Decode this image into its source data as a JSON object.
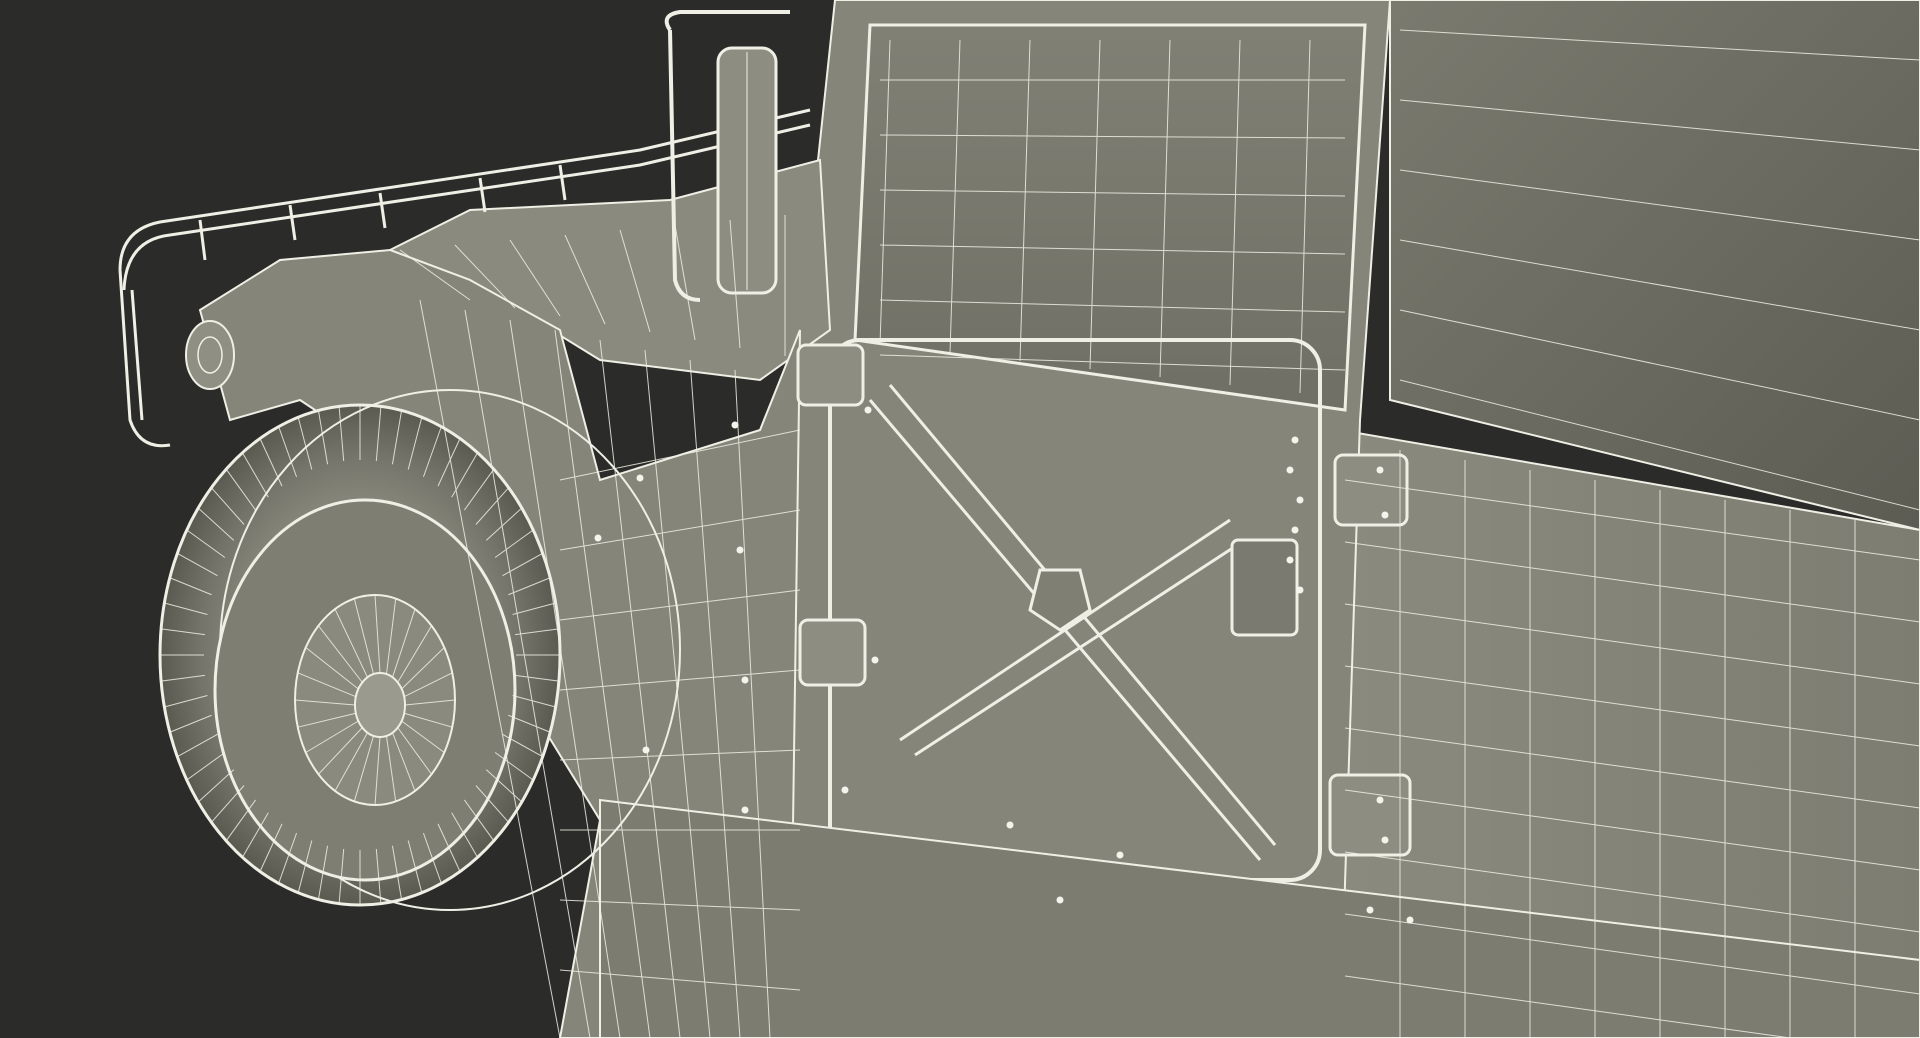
{
  "scene": {
    "subject": "wireframe-vehicle",
    "colors": {
      "background": "#2b2b29",
      "body_light": "#8f8f83",
      "body_mid": "#7b7b70",
      "body_dark": "#5f5f56",
      "wire": "#efefe6",
      "tire": "#6d6d63",
      "tire_dark": "#4a4a43",
      "glass": "#7a7a70"
    }
  }
}
